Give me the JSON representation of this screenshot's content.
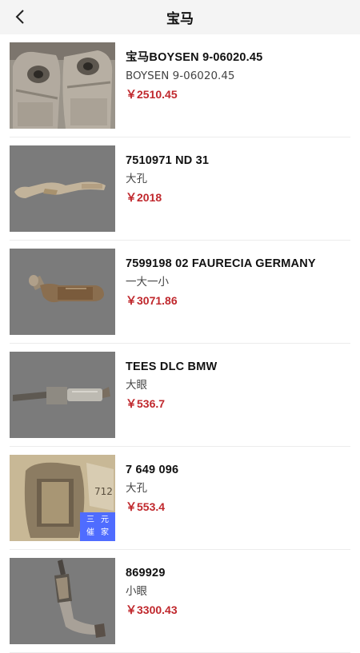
{
  "header": {
    "title": "宝马",
    "back_icon": "chevron-left-icon"
  },
  "colors": {
    "price": "#c0282d",
    "badge": "#4f6cff",
    "header_bg": "#f4f4f4"
  },
  "items": [
    {
      "name": "宝马BOYSEN 9-06020.45",
      "desc": "BOYSEN 9-06020.45",
      "price": "￥2510.45"
    },
    {
      "name": "7510971 ND 31",
      "desc": "大孔",
      "price": "￥2018"
    },
    {
      "name": "7599198 02 FAURECIA GERMANY",
      "desc": "一大一小",
      "price": "￥3071.86"
    },
    {
      "name": "TEES DLC BMW",
      "desc": "大眼",
      "price": "￥536.7"
    },
    {
      "name": "7 649 096",
      "desc": "大孔",
      "price": "￥553.4",
      "badge": [
        "三",
        "元",
        "催",
        "家"
      ]
    },
    {
      "name": "869929",
      "desc": "小眼",
      "price": "￥3300.43"
    }
  ]
}
